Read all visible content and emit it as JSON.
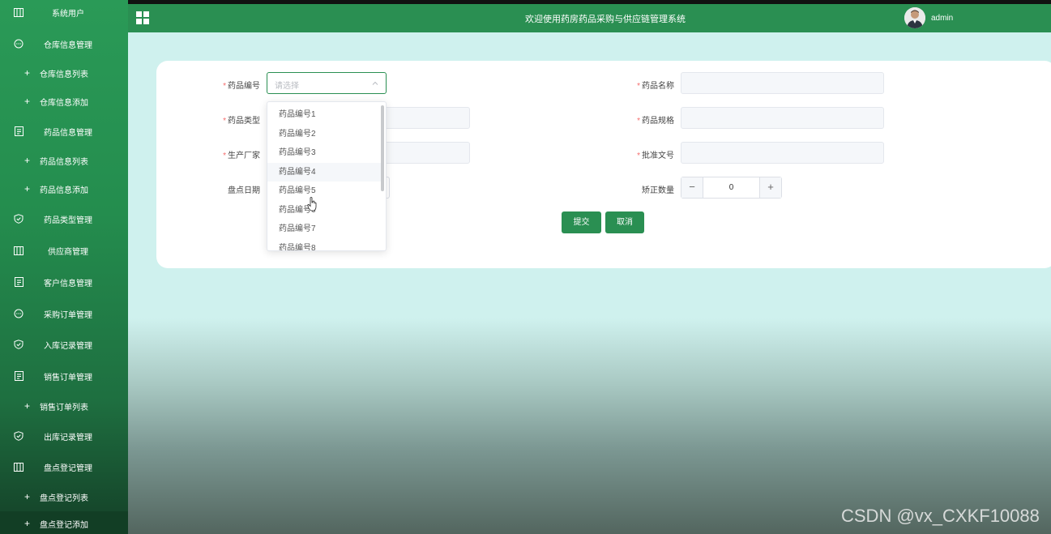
{
  "app": {
    "title": "欢迎使用药房药品采购与供应链管理系统",
    "username": "admin"
  },
  "sidebar": {
    "items": [
      {
        "label": "系统用户",
        "icon": "columns-icon",
        "type": "menu"
      },
      {
        "label": "仓库信息管理",
        "icon": "chat-icon",
        "type": "menu"
      },
      {
        "label": "仓库信息列表",
        "icon": "plus-icon",
        "type": "sub"
      },
      {
        "label": "仓库信息添加",
        "icon": "plus-icon",
        "type": "sub"
      },
      {
        "label": "药品信息管理",
        "icon": "document-icon",
        "type": "menu"
      },
      {
        "label": "药品信息列表",
        "icon": "plus-icon",
        "type": "sub"
      },
      {
        "label": "药品信息添加",
        "icon": "plus-icon",
        "type": "sub"
      },
      {
        "label": "药品类型管理",
        "icon": "shield-check-icon",
        "type": "menu"
      },
      {
        "label": "供应商管理",
        "icon": "columns-icon",
        "type": "menu"
      },
      {
        "label": "客户信息管理",
        "icon": "document-icon",
        "type": "menu"
      },
      {
        "label": "采购订单管理",
        "icon": "chat-icon",
        "type": "menu"
      },
      {
        "label": "入库记录管理",
        "icon": "shield-check-icon",
        "type": "menu"
      },
      {
        "label": "销售订单管理",
        "icon": "document-icon",
        "type": "menu"
      },
      {
        "label": "销售订单列表",
        "icon": "plus-icon",
        "type": "sub"
      },
      {
        "label": "出库记录管理",
        "icon": "shield-check-icon",
        "type": "menu"
      },
      {
        "label": "盘点登记管理",
        "icon": "columns-icon",
        "type": "menu"
      },
      {
        "label": "盘点登记列表",
        "icon": "plus-icon",
        "type": "sub"
      },
      {
        "label": "盘点登记添加",
        "icon": "plus-icon",
        "type": "sub",
        "active": true
      }
    ]
  },
  "form": {
    "drug_code": {
      "label": "药品编号",
      "placeholder": "请选择",
      "required": true
    },
    "drug_name": {
      "label": "药品名称",
      "required": true,
      "value": ""
    },
    "drug_type": {
      "label": "药品类型",
      "required": true,
      "value": ""
    },
    "drug_spec": {
      "label": "药品规格",
      "required": true,
      "value": ""
    },
    "manufacturer": {
      "label": "生产厂家",
      "required": true,
      "value": ""
    },
    "approval_no": {
      "label": "批准文号",
      "required": true,
      "value": ""
    },
    "check_date": {
      "label": "盘点日期",
      "required": false,
      "value": ""
    },
    "correction_qty": {
      "label": "矫正数量",
      "value": "0",
      "minus": "−",
      "plus": "+"
    },
    "submit_label": "提交",
    "cancel_label": "取消"
  },
  "dropdown": {
    "options": [
      "药品编号1",
      "药品编号2",
      "药品编号3",
      "药品编号4",
      "药品编号5",
      "药品编号6",
      "药品编号7",
      "药品编号8"
    ],
    "hovered": "药品编号4"
  },
  "watermark": "CSDN @vx_CXKF10088",
  "colors": {
    "primary": "#2a8f52",
    "required": "#f56c6c",
    "sidebar_active": "#123e25"
  }
}
